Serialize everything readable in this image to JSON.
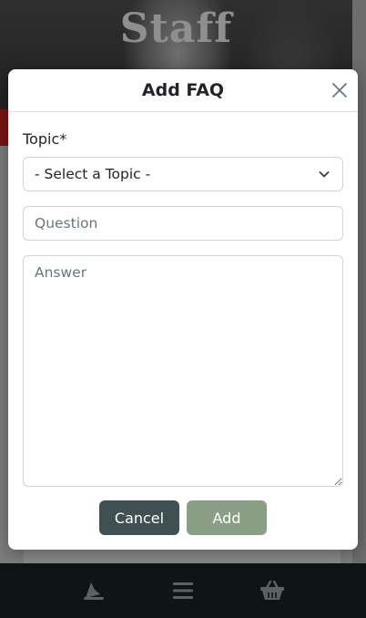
{
  "background": {
    "hero_title": "Staff"
  },
  "modal": {
    "title": "Add FAQ",
    "topic_label": "Topic*",
    "topic_select": {
      "selected": "- Select a Topic -"
    },
    "question_placeholder": "Question",
    "answer_placeholder": "Answer",
    "cancel_label": "Cancel",
    "add_label": "Add"
  },
  "footer": {
    "icons": [
      "wizard-hat-icon",
      "menu-icon",
      "basket-icon"
    ]
  },
  "colors": {
    "cancel_button": "#3f4f52",
    "add_button": "#8a9e86",
    "footer_bg": "#0f1416"
  }
}
